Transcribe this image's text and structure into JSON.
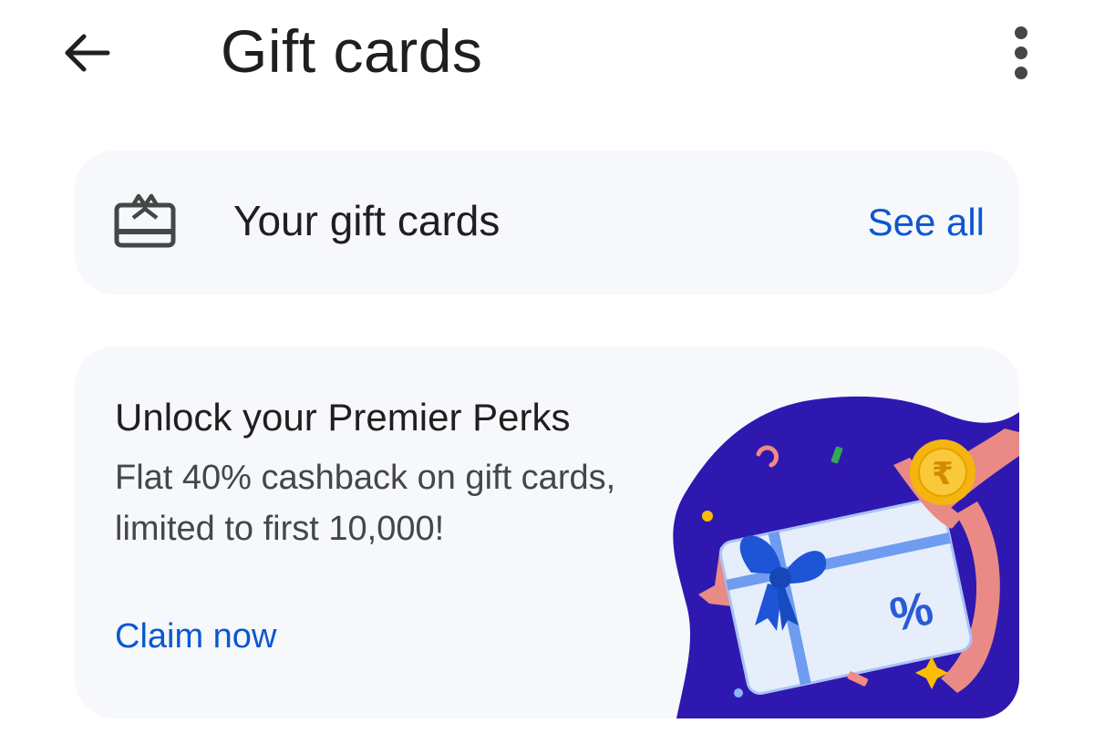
{
  "app_bar": {
    "back_icon": "arrow-back-icon",
    "title": "Gift cards",
    "more_icon": "more-vert-icon"
  },
  "your_gift_cards": {
    "icon": "gift-card-icon",
    "label": "Your gift cards",
    "see_all_label": "See all"
  },
  "promo": {
    "title": "Unlock your Premier Perks",
    "description": "Flat 40% cashback on gift cards, limited to first 10,000!",
    "claim_label": "Claim now",
    "coin_symbol": "₹",
    "card_symbol": "%"
  },
  "colors": {
    "accent": "#0b57d0",
    "card_background": "#f6f8fc",
    "illustration_blob": "#2f18b0",
    "ribbon": "#e98a86",
    "coin": "#f5b50f"
  }
}
